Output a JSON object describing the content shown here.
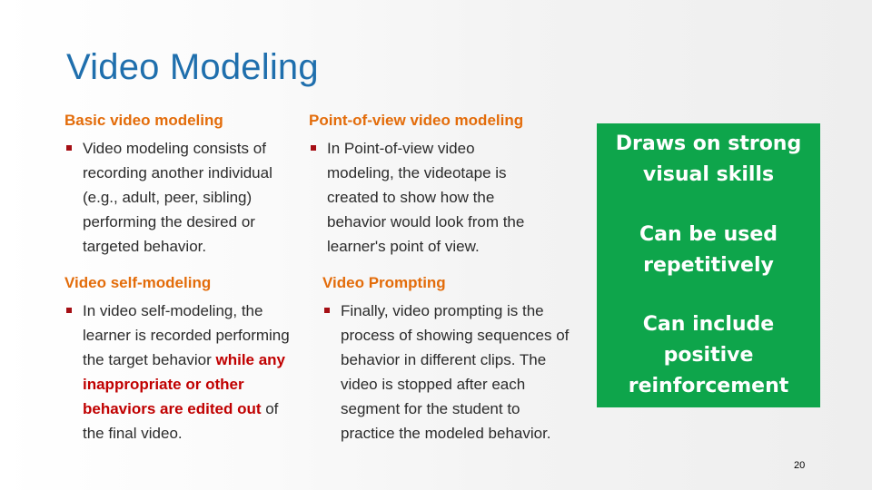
{
  "slide": {
    "title": "Video Modeling",
    "page_number": "20",
    "colors": {
      "title": "#1f6fad",
      "section_heading": "#e36c0a",
      "bullet": "#a50f15",
      "highlight": "#c00000",
      "green_box": "#0ea54b"
    }
  },
  "sections": [
    {
      "heading": "Basic video modeling",
      "bullet_lines": [
        "Video modeling consists of",
        "recording another individual",
        "(e.g., adult, peer, sibling)",
        "performing the desired or",
        "targeted behavior."
      ]
    },
    {
      "heading": "Point-of-view video modeling",
      "bullet_lines": [
        "In Point-of-view video",
        "modeling, the videotape is",
        "created to show how the",
        "behavior would look from the",
        "learner's point of view."
      ]
    },
    {
      "heading": "Video self-modeling",
      "bullet_parts": {
        "line1": "In video self-modeling, the",
        "line2": "learner is recorded performing",
        "line3_plain": "the target behavior ",
        "line3_hl": "while any",
        "line4_hl": "inappropriate or other",
        "line5_hl": "behaviors are edited out",
        "line5_plain": " of",
        "line6": "the final video."
      }
    },
    {
      "heading": "Video Prompting",
      "bullet_lines": [
        "Finally, video prompting is the",
        "process of showing sequences of",
        "behavior in different clips. The",
        "video is stopped after each",
        "segment for the student to",
        "practice the modeled behavior."
      ]
    }
  ],
  "green_box": {
    "items": [
      [
        "Draws on strong",
        "visual skills"
      ],
      [
        "Can be used",
        "repetitively"
      ],
      [
        "Can include",
        "positive",
        "reinforcement"
      ]
    ]
  }
}
